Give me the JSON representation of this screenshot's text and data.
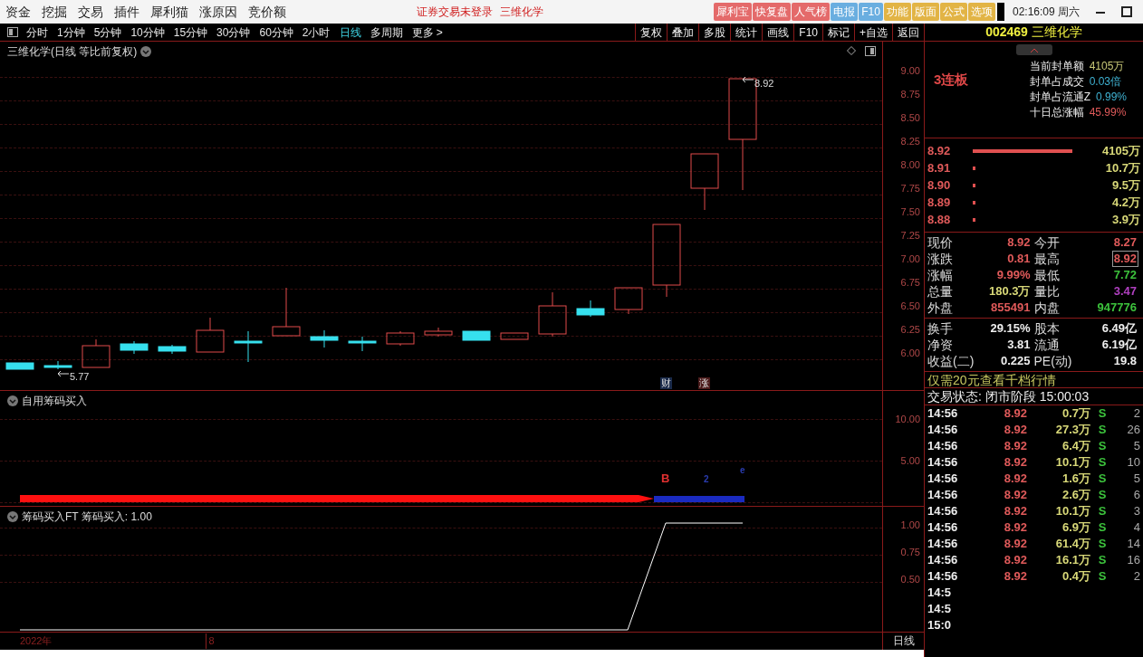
{
  "menu": [
    "资金",
    "挖掘",
    "交易",
    "插件",
    "犀利猫",
    "涨原因",
    "竞价额"
  ],
  "status_text": "证券交易未登录",
  "stock_title": "三维化学",
  "quick_buttons": [
    {
      "label": "犀利宝",
      "color": "#e46a6a"
    },
    {
      "label": "快复盘",
      "color": "#e46a6a"
    },
    {
      "label": "人气榜",
      "color": "#e46a6a"
    },
    {
      "label": "电报",
      "color": "#6aaee0"
    },
    {
      "label": "F10",
      "color": "#6aaee0"
    },
    {
      "label": "功能",
      "color": "#e2b445"
    },
    {
      "label": "版面",
      "color": "#e2b445"
    },
    {
      "label": "公式",
      "color": "#e2b445"
    },
    {
      "label": "选项",
      "color": "#e2b445"
    }
  ],
  "clock": "02:16:09 周六",
  "periods": [
    {
      "label": "分时",
      "selected": false
    },
    {
      "label": "1分钟",
      "selected": false
    },
    {
      "label": "5分钟",
      "selected": false
    },
    {
      "label": "10分钟",
      "selected": false
    },
    {
      "label": "15分钟",
      "selected": false
    },
    {
      "label": "30分钟",
      "selected": false
    },
    {
      "label": "60分钟",
      "selected": false
    },
    {
      "label": "2小时",
      "selected": false
    },
    {
      "label": "日线",
      "selected": true
    },
    {
      "label": "多周期",
      "selected": false
    },
    {
      "label": "更多 >",
      "selected": false
    }
  ],
  "tools": [
    "复权",
    "叠加",
    "多股",
    "统计",
    "画线",
    "F10",
    "标记",
    "+自选",
    "返回"
  ],
  "main_chart": {
    "title": "三维化学(日线 等比前复权)",
    "high_label": "8.92",
    "low_label": "5.77",
    "badges": [
      "财",
      "涨"
    ],
    "axis": [
      "9.00",
      "8.75",
      "8.50",
      "8.25",
      "8.00",
      "7.75",
      "7.50",
      "7.25",
      "7.00",
      "6.75",
      "6.50",
      "6.25",
      "6.00"
    ]
  },
  "indicator_1": {
    "title": "自用筹码买入",
    "axis": [
      "10.00",
      "5.00"
    ],
    "markers": [
      {
        "text": "B",
        "color": "#e03030"
      },
      {
        "text": "2",
        "color": "#2a3cb0"
      },
      {
        "text": "e",
        "color": "#2a3cb0"
      }
    ]
  },
  "indicator_2": {
    "title": "筹码买入FT 筹码买入: 1.00",
    "axis": [
      "1.00",
      "0.75",
      "0.50"
    ]
  },
  "date_axis": [
    "2022年",
    "8"
  ],
  "period_label": "日线",
  "quote": {
    "code": "002469",
    "name": "三维化学",
    "streak": "3连板",
    "seal_info": [
      {
        "label": "当前封单额",
        "value": "4105万",
        "color": "#c8c878"
      },
      {
        "label": "封单占成交",
        "value": "0.03倍",
        "color": "#3fb2d2"
      },
      {
        "label": "封单占流通Z",
        "value": "0.99%",
        "color": "#3fb2d2"
      },
      {
        "label": "十日总涨幅",
        "value": "45.99%",
        "color": "#e05a5a"
      }
    ],
    "order_book": [
      {
        "price": "8.92",
        "volume": "4105万"
      },
      {
        "price": "8.91",
        "volume": "10.7万"
      },
      {
        "price": "8.90",
        "volume": "9.5万"
      },
      {
        "price": "8.89",
        "volume": "4.2万"
      },
      {
        "price": "8.88",
        "volume": "3.9万"
      }
    ],
    "stats": [
      {
        "label": "现价",
        "value": "8.92",
        "color": "#e05a5a",
        "boxed": false
      },
      {
        "label": "今开",
        "value": "8.27",
        "color": "#e05a5a",
        "boxed": false
      },
      {
        "label": "涨跌",
        "value": "0.81",
        "color": "#e05a5a",
        "boxed": false
      },
      {
        "label": "最高",
        "value": "8.92",
        "color": "#e05a5a",
        "boxed": true
      },
      {
        "label": "涨幅",
        "value": "9.99%",
        "color": "#e05a5a",
        "boxed": false
      },
      {
        "label": "最低",
        "value": "7.72",
        "color": "#3cc23c",
        "boxed": false
      },
      {
        "label": "总量",
        "value": "180.3万",
        "color": "#d8d878",
        "boxed": false
      },
      {
        "label": "量比",
        "value": "3.47",
        "color": "#b040c0",
        "boxed": false
      },
      {
        "label": "外盘",
        "value": "855491",
        "color": "#e05a5a",
        "boxed": false
      },
      {
        "label": "内盘",
        "value": "947776",
        "color": "#3cc23c",
        "boxed": false
      }
    ],
    "fundamentals": [
      {
        "label": "换手",
        "value": "29.15%"
      },
      {
        "label": "股本",
        "value": "6.49亿"
      },
      {
        "label": "净资",
        "value": "3.81"
      },
      {
        "label": "流通",
        "value": "6.19亿"
      },
      {
        "label": "收益(二)",
        "value": "0.225"
      },
      {
        "label": "PE(动)",
        "value": "19.8"
      }
    ],
    "promo": "仅需20元查看千档行情",
    "trade_status": "交易状态: 闭市阶段 15:00:03",
    "trades": [
      {
        "time": "14:56",
        "price": "8.92",
        "volume": "0.7万",
        "side": "S",
        "count": "2"
      },
      {
        "time": "14:56",
        "price": "8.92",
        "volume": "27.3万",
        "side": "S",
        "count": "26"
      },
      {
        "time": "14:56",
        "price": "8.92",
        "volume": "6.4万",
        "side": "S",
        "count": "5"
      },
      {
        "time": "14:56",
        "price": "8.92",
        "volume": "10.1万",
        "side": "S",
        "count": "10"
      },
      {
        "time": "14:56",
        "price": "8.92",
        "volume": "1.6万",
        "side": "S",
        "count": "5"
      },
      {
        "time": "14:56",
        "price": "8.92",
        "volume": "2.6万",
        "side": "S",
        "count": "6"
      },
      {
        "time": "14:56",
        "price": "8.92",
        "volume": "10.1万",
        "side": "S",
        "count": "3"
      },
      {
        "time": "14:56",
        "price": "8.92",
        "volume": "6.9万",
        "side": "S",
        "count": "4"
      },
      {
        "time": "14:56",
        "price": "8.92",
        "volume": "61.4万",
        "side": "S",
        "count": "14"
      },
      {
        "time": "14:56",
        "price": "8.92",
        "volume": "16.1万",
        "side": "S",
        "count": "16"
      },
      {
        "time": "14:56",
        "price": "8.92",
        "volume": "0.4万",
        "side": "S",
        "count": "2"
      },
      {
        "time": "14:5"
      },
      {
        "time": "14:5"
      },
      {
        "time": "15:0"
      }
    ]
  }
}
